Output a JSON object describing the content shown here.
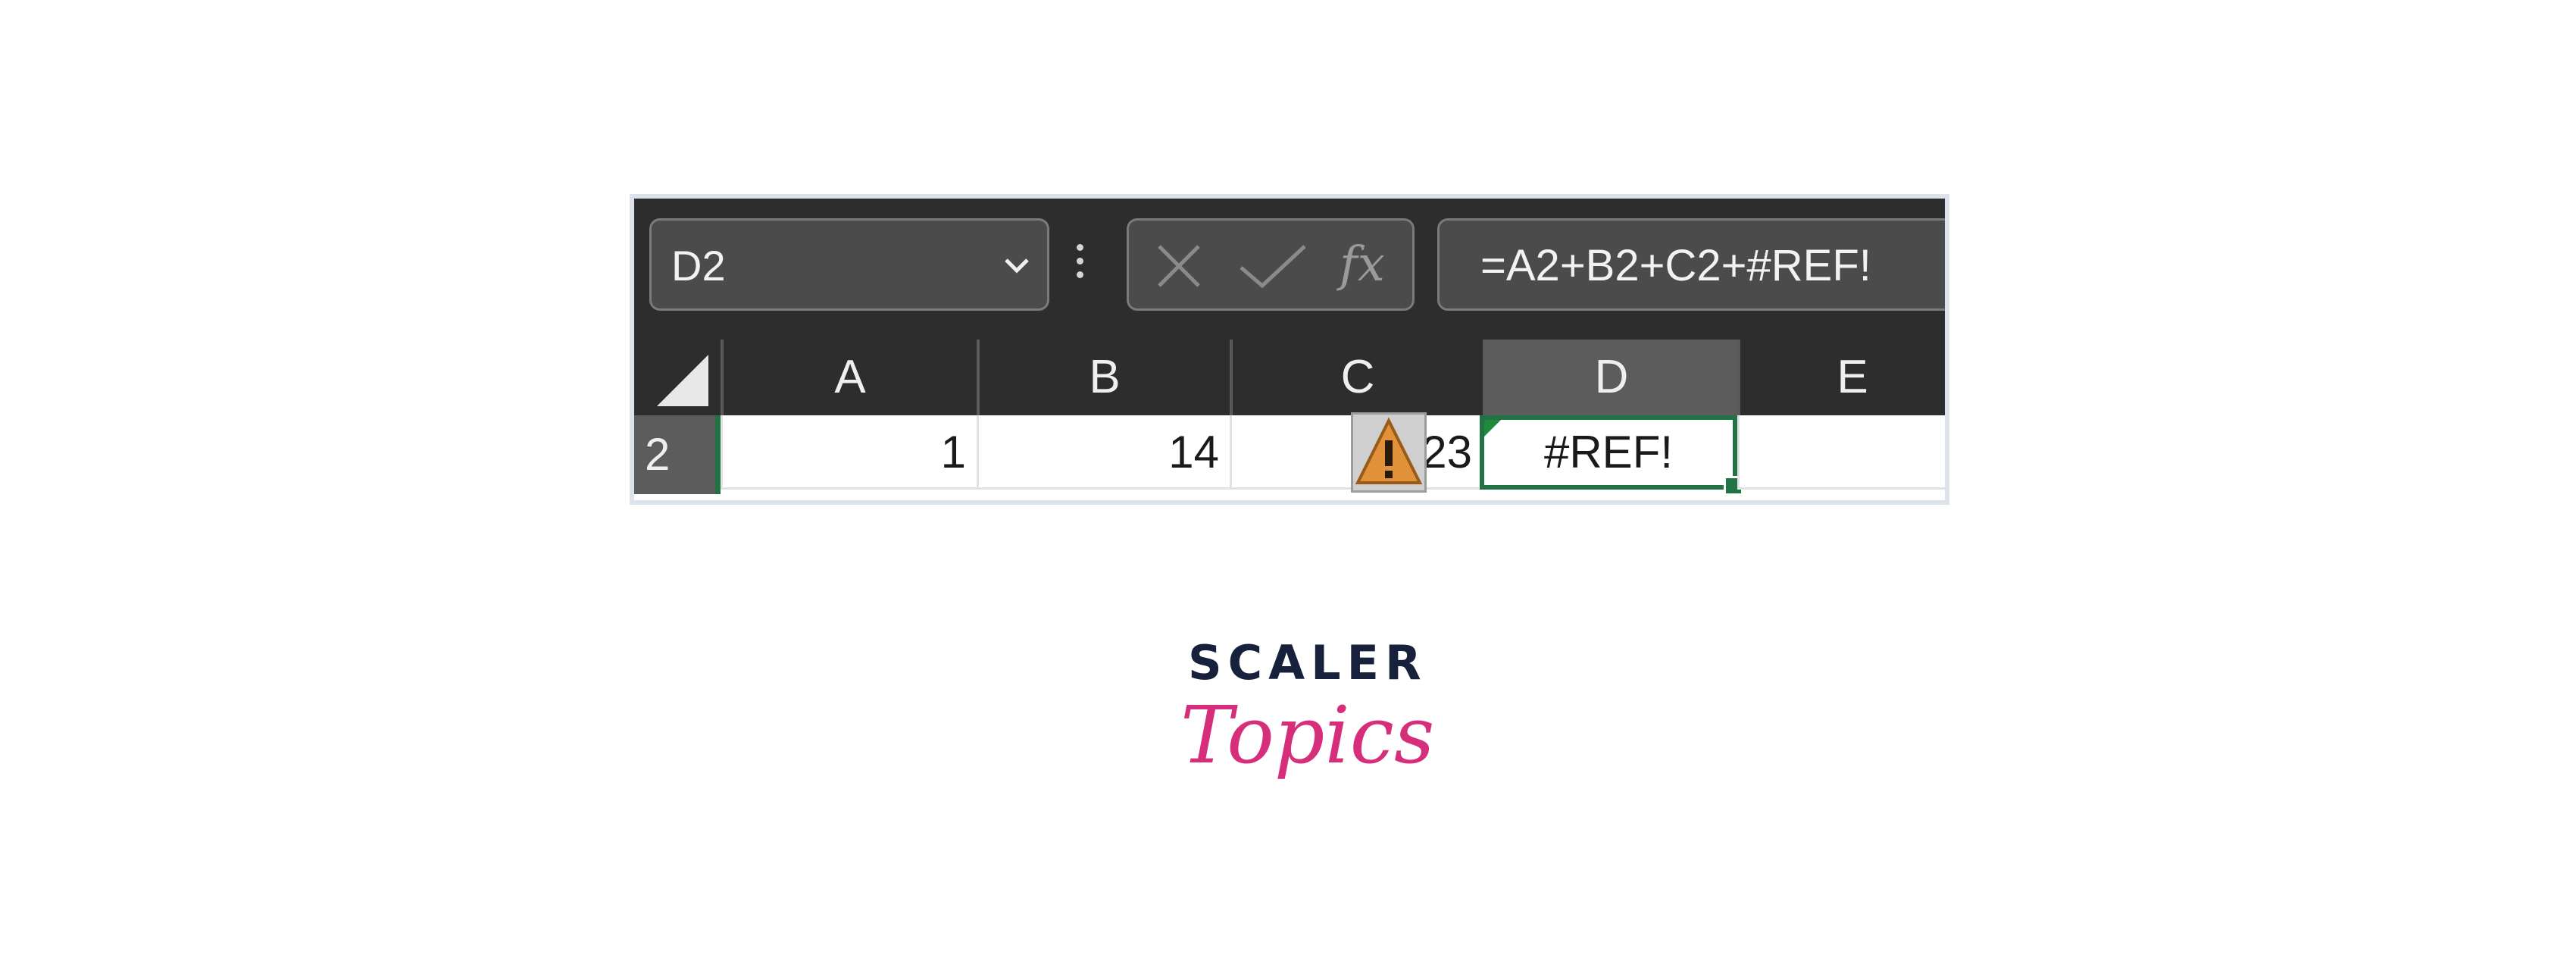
{
  "formula_bar": {
    "name_box": "D2",
    "formula": "=A2+B2+C2+#REF!",
    "fx_label": "fx",
    "icons": [
      "chevron-down-icon",
      "more-options-icon",
      "cancel-icon",
      "enter-icon"
    ]
  },
  "sheet": {
    "columns": [
      "A",
      "B",
      "C",
      "D",
      "E"
    ],
    "selected_column": "D",
    "row": {
      "label": "2",
      "cells": [
        "1",
        "14",
        "23",
        "#REF!",
        ""
      ]
    },
    "warning_icon": "warning-icon",
    "colors": {
      "accent": "#217346",
      "error_triangle": "#1f8a3b",
      "warning": "#e0913a"
    }
  },
  "logo": {
    "line1": "SCALER",
    "line2": "Topics",
    "colors": {
      "line1": "#18213b",
      "line2": "#d62e7a"
    }
  }
}
